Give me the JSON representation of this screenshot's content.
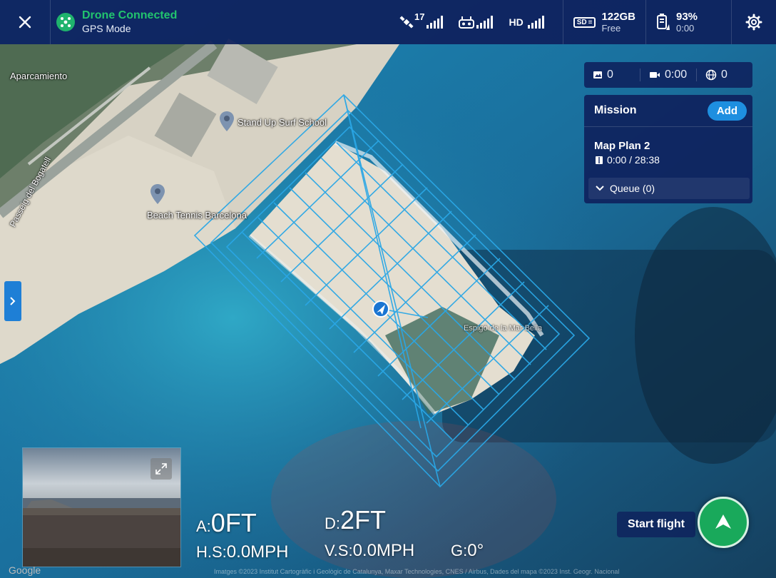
{
  "status": {
    "title": "Drone Connected",
    "subtitle": "GPS Mode",
    "icons": [
      "close-icon",
      "drone-status-icon"
    ]
  },
  "signals": {
    "satellite_count": "17",
    "video_label": "HD"
  },
  "storage": {
    "card_label": "SD",
    "value": "122GB",
    "sub": "Free"
  },
  "battery": {
    "value": "93%",
    "sub": "0:00"
  },
  "media": {
    "photos": "0",
    "video_time": "0:00",
    "panoramas": "0"
  },
  "mission": {
    "title": "Mission",
    "add_label": "Add",
    "plan_name": "Map Plan 2",
    "plan_time": "0:00 / 28:38",
    "queue_label": "Queue (0)"
  },
  "map": {
    "labels": {
      "parking": "Aparcamiento",
      "surf_school": "Stand Up Surf School",
      "beach_tennis": "Beach Tennis Barcelona",
      "street": "Passeig del Bogatell",
      "jetty": "Espigó de la Mar Bella"
    },
    "google": "Google",
    "attribution": "Imatges ©2023 Institut Cartogràfic i Geològic de Catalunya, Maxar Technologies, CNES / Airbus, Dades del mapa ©2023 Inst. Geogr. Nacional"
  },
  "telemetry": {
    "altitude_label": "A:",
    "altitude_value": "0FT",
    "distance_label": "D:",
    "distance_value": "2FT",
    "hspeed_label": "H.S:",
    "hspeed_value": "0.0MPH",
    "vspeed_label": "V.S:",
    "vspeed_value": "0.0MPH",
    "gimbal_label": "G:",
    "gimbal_value": "0°"
  },
  "actions": {
    "start_flight": "Start flight"
  },
  "colors": {
    "topbar": "#0e205c",
    "connected_green": "#22c46e",
    "accent_blue": "#1e8fe0",
    "start_green": "#19a95b",
    "grid_blue": "#2aa7e6"
  }
}
